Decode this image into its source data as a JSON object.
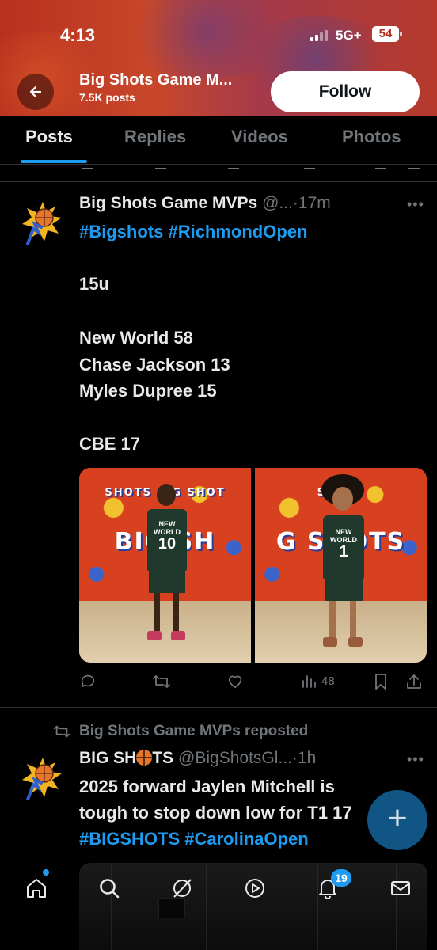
{
  "status_bar": {
    "time": "4:13",
    "network": "5G+",
    "battery": "54"
  },
  "header": {
    "title": "Big Shots Game M...",
    "subtitle": "7.5K posts",
    "follow_label": "Follow"
  },
  "tabs": [
    {
      "label": "Posts",
      "active": true
    },
    {
      "label": "Replies",
      "active": false
    },
    {
      "label": "Videos",
      "active": false
    },
    {
      "label": "Photos",
      "active": false
    }
  ],
  "post1": {
    "author": "Big Shots Game MVPs",
    "handle": "@...",
    "time": "·17m",
    "hashtags": "#Bigshots #RichmondOpen",
    "lines": [
      "15u",
      "New World 58",
      "Chase Jackson 13",
      "Myles Dupree 15",
      "CBE 17"
    ],
    "photos": [
      {
        "wall_top": "SHOTS BIG SHOT",
        "wall_mid": "BIG SH",
        "jersey_text": "NEW WORLD",
        "jersey_number": "10"
      },
      {
        "wall_top": "SHOTS",
        "wall_mid": "G SHOTS",
        "jersey_text": "NEW WORLD",
        "jersey_number": "1"
      }
    ],
    "views": "48"
  },
  "post2": {
    "repost_label": "Big Shots Game MVPs reposted",
    "author_prefix": "BIG SH",
    "author_suffix": "TS",
    "handle": "@BigShotsGl...",
    "time": "·1h",
    "line1": "2025 forward Jaylen Mitchell is",
    "line2": "tough to stop down low for T1 17",
    "hashtags": "#BIGSHOTS #CarolinaOpen"
  },
  "bottom_nav": {
    "notification_count": "19"
  },
  "colors": {
    "accent": "#1d9bf0",
    "muted": "#71767b",
    "text": "#e7e9ea",
    "banner": "#b8301f"
  },
  "icons": [
    "back-arrow-icon",
    "more-icon",
    "reply-icon",
    "repost-icon",
    "like-icon",
    "views-icon",
    "bookmark-icon",
    "share-icon",
    "home-icon",
    "search-icon",
    "grok-icon",
    "communities-icon",
    "bell-icon",
    "mail-icon",
    "plus-icon"
  ]
}
